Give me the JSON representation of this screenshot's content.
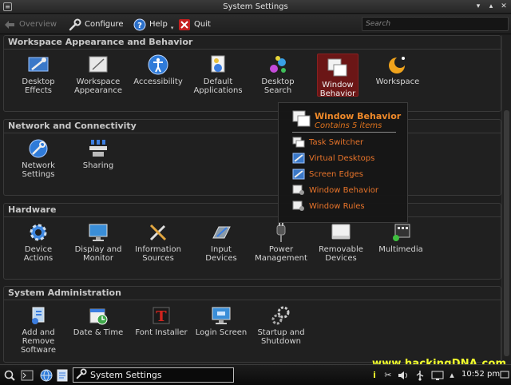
{
  "window": {
    "title": "System Settings"
  },
  "toolbar": {
    "overview_label": "Overview",
    "configure_label": "Configure",
    "help_label": "Help",
    "quit_label": "Quit",
    "search_placeholder": "Search"
  },
  "sections": {
    "workspace": {
      "title": "Workspace Appearance and Behavior",
      "items": [
        {
          "label1": "Desktop",
          "label2": "Effects",
          "icon": "desktop-effects-icon"
        },
        {
          "label1": "Workspace",
          "label2": "Appearance",
          "icon": "workspace-appearance-icon"
        },
        {
          "label1": "Accessibility",
          "label2": "",
          "icon": "accessibility-icon"
        },
        {
          "label1": "Default",
          "label2": "Applications",
          "icon": "default-applications-icon"
        },
        {
          "label1": "Desktop",
          "label2": "Search",
          "icon": "desktop-search-icon"
        },
        {
          "label1": "Window",
          "label2": "Behavior",
          "icon": "window-behavior-icon"
        },
        {
          "label1": "Workspace",
          "label2": "",
          "icon": "workspace-icon"
        }
      ]
    },
    "network": {
      "title": "Network and Connectivity",
      "items": [
        {
          "label1": "Network",
          "label2": "Settings",
          "icon": "network-settings-icon"
        },
        {
          "label1": "Sharing",
          "label2": "",
          "icon": "sharing-icon"
        }
      ]
    },
    "hardware": {
      "title": "Hardware",
      "items": [
        {
          "label1": "Device",
          "label2": "Actions",
          "icon": "gear-icon"
        },
        {
          "label1": "Display and",
          "label2": "Monitor",
          "icon": "monitor-icon"
        },
        {
          "label1": "Information",
          "label2": "Sources",
          "icon": "tools-icon"
        },
        {
          "label1": "Input",
          "label2": "Devices",
          "icon": "input-devices-icon"
        },
        {
          "label1": "Power",
          "label2": "Management",
          "icon": "power-plug-icon"
        },
        {
          "label1": "Removable",
          "label2": "Devices",
          "icon": "drive-icon"
        },
        {
          "label1": "Multimedia",
          "label2": "",
          "icon": "multimedia-icon"
        }
      ]
    },
    "sysadmin": {
      "title": "System Administration",
      "items": [
        {
          "label1": "Add and",
          "label2": "Remove",
          "label3": "Software",
          "icon": "software-icon"
        },
        {
          "label1": "Date & Time",
          "label2": "",
          "icon": "clock-icon"
        },
        {
          "label1": "Font Installer",
          "label2": "",
          "icon": "font-icon"
        },
        {
          "label1": "Login Screen",
          "label2": "",
          "icon": "login-screen-icon"
        },
        {
          "label1": "Startup and",
          "label2": "Shutdown",
          "icon": "startup-gears-icon"
        }
      ]
    }
  },
  "popup": {
    "title": "Window Behavior",
    "subtitle": "Contains 5 items",
    "items": [
      "Task Switcher",
      "Virtual Desktops",
      "Screen Edges",
      "Window Behavior",
      "Window Rules"
    ]
  },
  "taskbar": {
    "task_label": "System Settings",
    "clock": "10:52 pm",
    "watermark": "www.hackingDNA.com"
  },
  "colors": {
    "accent_orange": "#f08a2a",
    "selection_red": "#6b1616",
    "watermark_yellow": "#f1ff2c"
  }
}
